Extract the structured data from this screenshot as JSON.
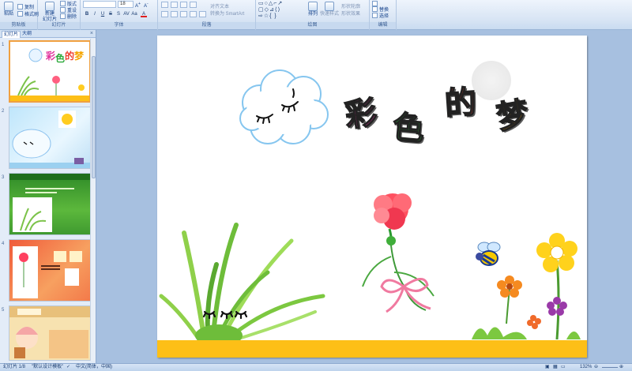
{
  "ribbon": {
    "groups": {
      "clipboard": "剪贴板",
      "slides": "幻灯片",
      "font": "字体",
      "paragraph": "段落",
      "drawing": "绘图",
      "editing": "编辑"
    },
    "clipboard": {
      "paste": "粘贴",
      "copy": "复制",
      "format_painter": "格式刷"
    },
    "slides": {
      "new_slide": "新建\n幻灯片",
      "layout": "版式",
      "reset": "重设",
      "delete": "删除"
    },
    "font": {
      "size": "18"
    },
    "paragraph": {
      "align_text": "对齐文本",
      "convert_smartart": "转换为 SmartArt"
    },
    "drawing": {
      "arrange": "排列",
      "quick_styles": "快速样式",
      "shape_fill": "形状轮廓",
      "shape_effects": "形状效果"
    },
    "editing": {
      "replace": "替换",
      "select": "选择"
    }
  },
  "left_pane": {
    "tabs": [
      "幻灯片",
      "大纲"
    ],
    "slides": [
      {
        "num": "1",
        "title": "彩色的梦"
      },
      {
        "num": "2",
        "title": ""
      },
      {
        "num": "3",
        "title": ""
      },
      {
        "num": "4",
        "title": ""
      },
      {
        "num": "5",
        "title": ""
      }
    ]
  },
  "slide": {
    "title_chars": [
      "彩",
      "色",
      "的",
      "梦"
    ],
    "colors": {
      "char1": "#e0309c",
      "char2": "#2eaa3c",
      "char3": "#ef3d2e",
      "char4": "#f5a500",
      "ground": "#fdbf17"
    }
  },
  "status": {
    "slide_info": "幻灯片 1/8",
    "theme": "\"默认设计模板\"",
    "language": "中文(简体，中国)",
    "zoom": "132%"
  }
}
